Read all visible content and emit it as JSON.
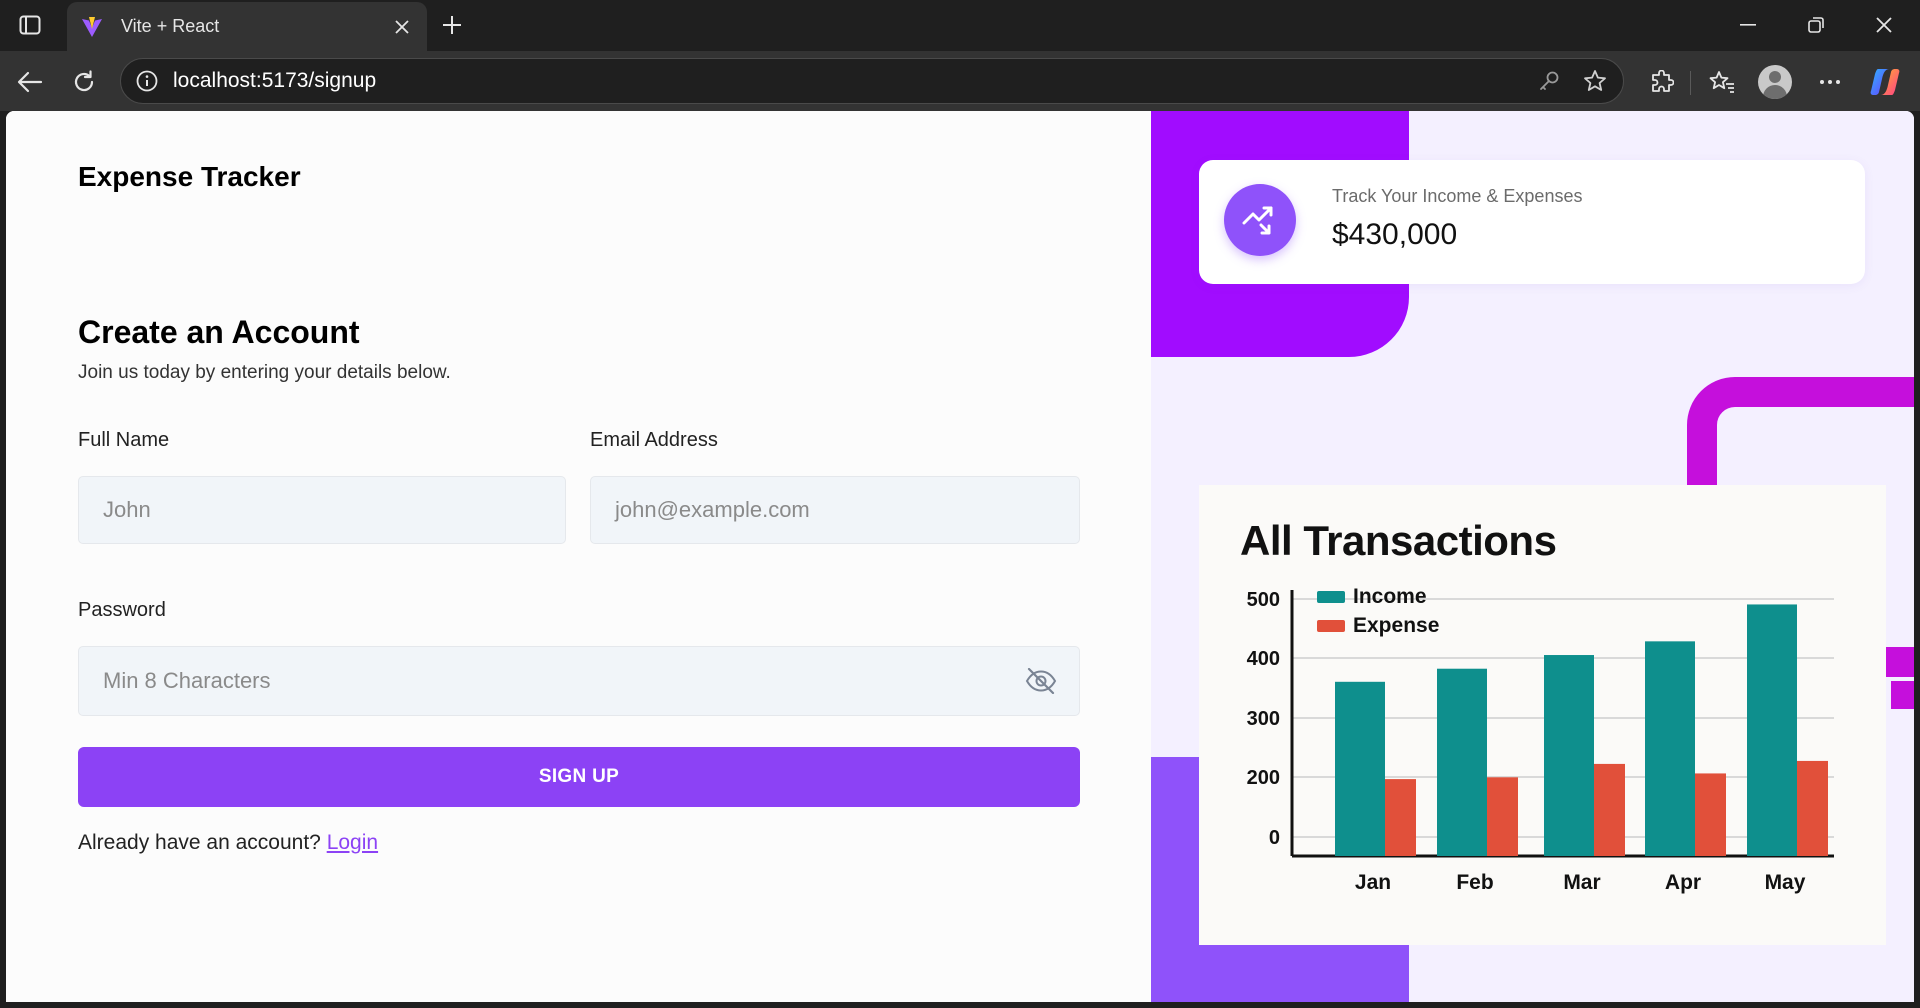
{
  "browser": {
    "tab_title": "Vite + React",
    "url": "localhost:5173/signup"
  },
  "page": {
    "app_title": "Expense Tracker",
    "heading": "Create an Account",
    "subheading": "Join us today by entering your details below.",
    "form": {
      "full_name_label": "Full Name",
      "full_name_placeholder": "John",
      "email_label": "Email Address",
      "email_placeholder": "john@example.com",
      "password_label": "Password",
      "password_placeholder": "Min 8 Characters",
      "submit_label": "SIGN UP"
    },
    "login_prompt": "Already have an account?",
    "login_link": "Login"
  },
  "side_panel": {
    "stat_label": "Track Your Income & Expenses",
    "stat_value": "$430,000"
  },
  "chart_data": {
    "type": "bar",
    "title": "All Transactions",
    "categories": [
      "Jan",
      "Feb",
      "Mar",
      "Apr",
      "May"
    ],
    "series": [
      {
        "name": "Income",
        "values": [
          360,
          382,
          405,
          428,
          490
        ],
        "color": "#0e8f8d"
      },
      {
        "name": "Expense",
        "values": [
          193,
          199,
          222,
          206,
          227
        ],
        "color": "#e1503a"
      }
    ],
    "y_ticks": [
      0,
      200,
      300,
      400,
      500
    ],
    "legend": "top-left",
    "grid": true
  },
  "colors": {
    "accent": "#8c42f5",
    "deco_purple": "#a10cff",
    "deco_magenta": "#c50fdc"
  }
}
